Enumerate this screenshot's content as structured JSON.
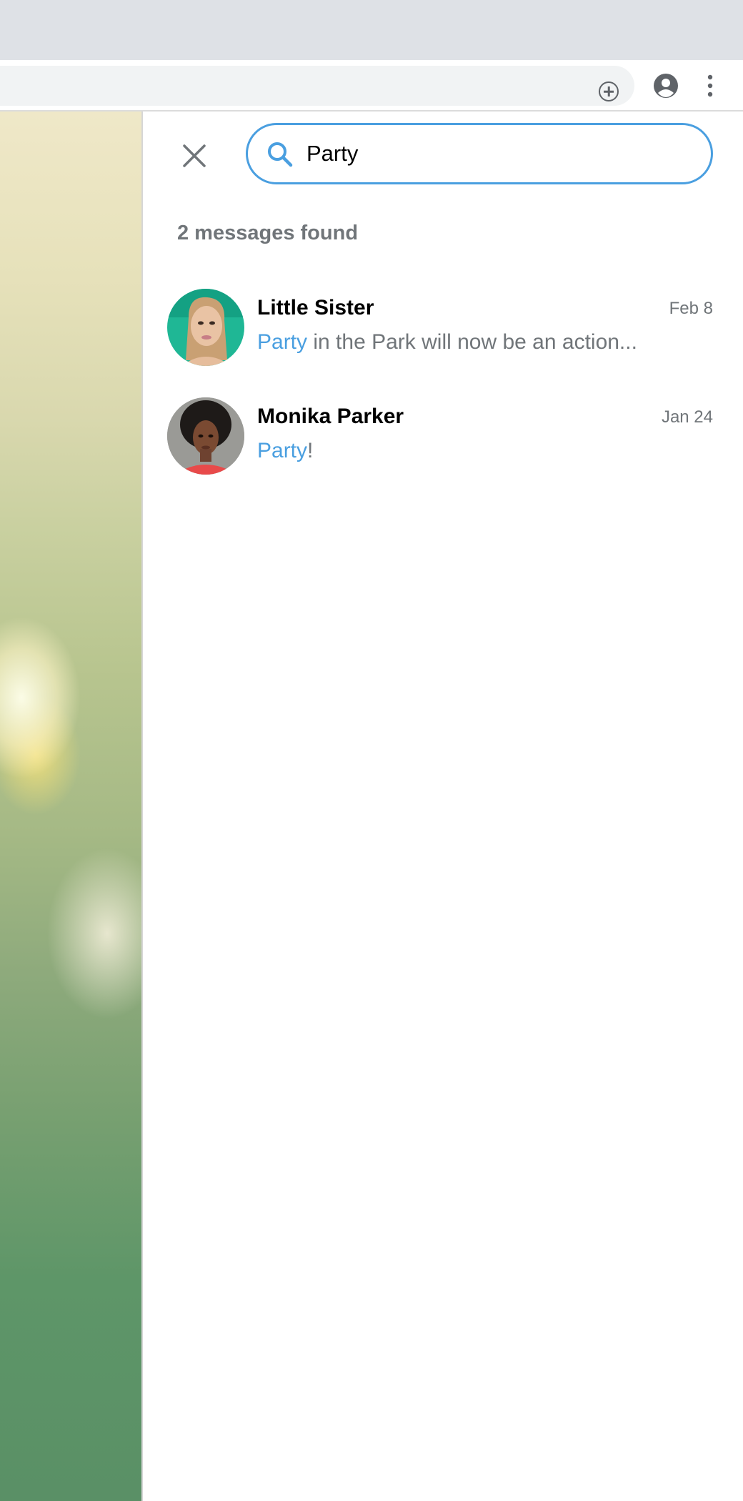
{
  "browser": {
    "icons": [
      "add-circle-icon",
      "account-circle-icon",
      "more-vert-icon"
    ]
  },
  "search": {
    "query": "Party",
    "results_count": "2 messages found"
  },
  "results": [
    {
      "name": "Little Sister",
      "date": "Feb 8",
      "highlight": "Party",
      "rest": " in the Park will now be an action..."
    },
    {
      "name": "Monika Parker",
      "date": "Jan 24",
      "highlight": "Party",
      "rest": "!"
    }
  ],
  "colors": {
    "accent": "#4a9fe0",
    "muted_text": "#707579"
  }
}
